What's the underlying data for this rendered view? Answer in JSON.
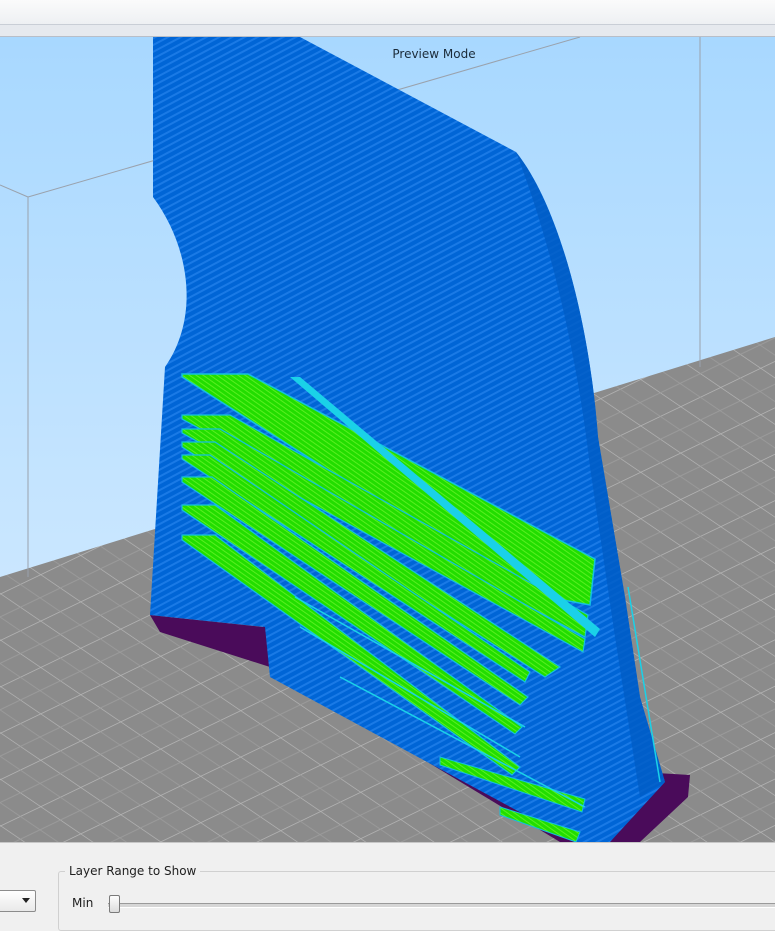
{
  "viewport": {
    "mode_label": "Preview Mode",
    "colors": {
      "sky_top": "#a8d8ff",
      "sky_bottom": "#dbeeff",
      "bed": "#8a8a8a",
      "model_blue": "#0067d8",
      "infill_green": "#22dd00",
      "skirt_purple": "#4a0b5a"
    }
  },
  "layer_range": {
    "group_title": "Layer Range to Show",
    "min_label": "Min",
    "min_value_fraction": 0.0
  },
  "view_select": {
    "arrow_icon": "chevron-down-icon"
  }
}
